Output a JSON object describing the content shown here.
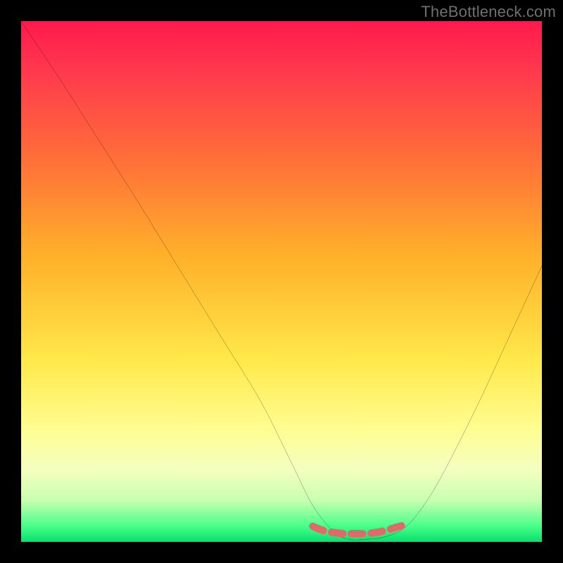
{
  "watermark": "TheBottleneck.com",
  "chart_data": {
    "type": "line",
    "title": "",
    "xlabel": "",
    "ylabel": "",
    "xlim": [
      0,
      100
    ],
    "ylim": [
      0,
      100
    ],
    "series": [
      {
        "name": "bottleneck-curve",
        "x": [
          0,
          8,
          15,
          22,
          30,
          38,
          46,
          52,
          56,
          60,
          63,
          66,
          70,
          74,
          78,
          82,
          88,
          94,
          100
        ],
        "values": [
          100,
          88,
          77,
          66,
          53,
          40,
          27,
          15,
          7,
          2,
          0.5,
          0.5,
          1,
          3,
          8,
          15,
          27,
          40,
          53
        ]
      },
      {
        "name": "ideal-band",
        "x": [
          56,
          58,
          60,
          62,
          64,
          66,
          68,
          70,
          72,
          74
        ],
        "values": [
          3.0,
          2.2,
          1.8,
          1.6,
          1.6,
          1.6,
          1.8,
          2.2,
          2.8,
          3.4
        ]
      }
    ],
    "background_gradient": {
      "stops": [
        {
          "pos": 0,
          "color": "#ff1a4d"
        },
        {
          "pos": 10,
          "color": "#ff3a4d"
        },
        {
          "pos": 25,
          "color": "#ff6a3a"
        },
        {
          "pos": 45,
          "color": "#ffb02a"
        },
        {
          "pos": 65,
          "color": "#ffe84a"
        },
        {
          "pos": 78,
          "color": "#fffd90"
        },
        {
          "pos": 86,
          "color": "#f4ffc0"
        },
        {
          "pos": 92,
          "color": "#c8ffb0"
        },
        {
          "pos": 97,
          "color": "#47ff8a"
        },
        {
          "pos": 100,
          "color": "#06e06f"
        }
      ]
    },
    "colors": {
      "curve": "#000000",
      "band": "#e06a6a"
    }
  }
}
